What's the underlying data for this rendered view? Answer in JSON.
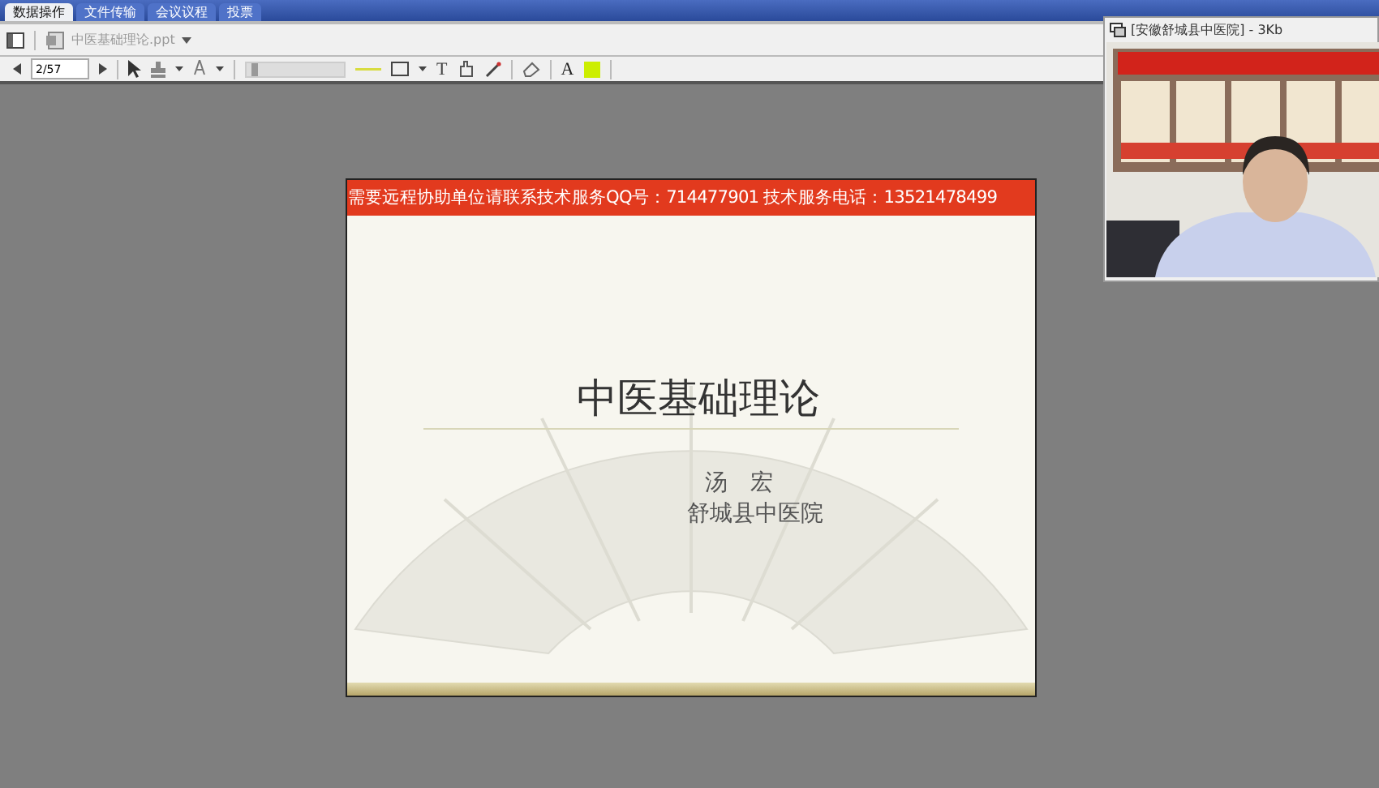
{
  "tabs": [
    {
      "label": "数据操作",
      "selected": true
    },
    {
      "label": "文件传输",
      "selected": false
    },
    {
      "label": "会议议程",
      "selected": false
    },
    {
      "label": "投票",
      "selected": false
    }
  ],
  "document": {
    "name": "中医基础理论.ppt"
  },
  "toolbar": {
    "page": "2/57",
    "line_width": {
      "level": 0.05
    },
    "text_tool": "T",
    "font_tool": "A",
    "color": "#ccee00"
  },
  "slide": {
    "banner": "需要远程协助单位请联系技术服务QQ号：714477901 技术服务电话：13521478499",
    "title": "中医基础理论",
    "presenter": "汤　宏",
    "institution": "舒城县中医院"
  },
  "video_window": {
    "title": "[安徽舒城县中医院] - 3Kb"
  }
}
